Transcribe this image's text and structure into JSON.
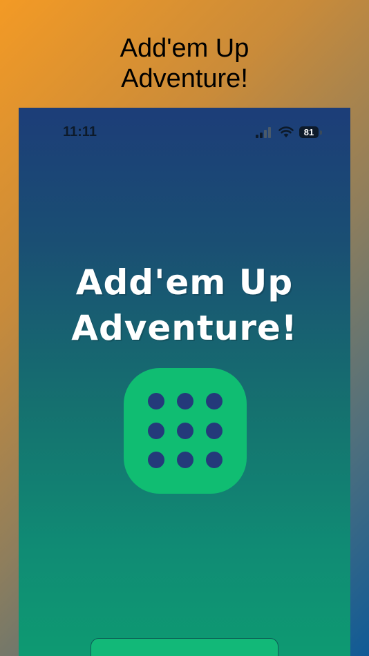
{
  "store_header": {
    "title_line1": "Add'em Up",
    "title_line2": "Adventure!"
  },
  "status_bar": {
    "time": "11:11",
    "battery_level": "81",
    "icons": [
      "signal-icon",
      "wifi-icon",
      "battery-icon"
    ]
  },
  "app": {
    "title_line1": "Add'em Up",
    "title_line2": "Adventure!",
    "logo": {
      "icon": "dice-nine-pips-icon",
      "pip_count": 9,
      "tile_color": "#10bd72",
      "pip_color": "#243a7a"
    },
    "start_button_color": "#12b878"
  },
  "colors": {
    "background_orange": "#f39a25",
    "background_blue": "#0f5a96",
    "screen_top": "#1c3d78",
    "screen_bottom": "#0e9a72"
  }
}
